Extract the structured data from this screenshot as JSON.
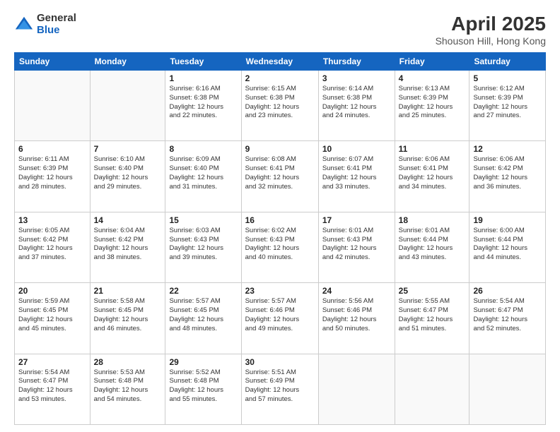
{
  "logo": {
    "general": "General",
    "blue": "Blue"
  },
  "title": "April 2025",
  "location": "Shouson Hill, Hong Kong",
  "days_of_week": [
    "Sunday",
    "Monday",
    "Tuesday",
    "Wednesday",
    "Thursday",
    "Friday",
    "Saturday"
  ],
  "weeks": [
    [
      null,
      null,
      {
        "day": "1",
        "sunrise": "6:16 AM",
        "sunset": "6:38 PM",
        "daylight": "12 hours and 22 minutes."
      },
      {
        "day": "2",
        "sunrise": "6:15 AM",
        "sunset": "6:38 PM",
        "daylight": "12 hours and 23 minutes."
      },
      {
        "day": "3",
        "sunrise": "6:14 AM",
        "sunset": "6:38 PM",
        "daylight": "12 hours and 24 minutes."
      },
      {
        "day": "4",
        "sunrise": "6:13 AM",
        "sunset": "6:39 PM",
        "daylight": "12 hours and 25 minutes."
      },
      {
        "day": "5",
        "sunrise": "6:12 AM",
        "sunset": "6:39 PM",
        "daylight": "12 hours and 27 minutes."
      }
    ],
    [
      {
        "day": "6",
        "sunrise": "6:11 AM",
        "sunset": "6:39 PM",
        "daylight": "12 hours and 28 minutes."
      },
      {
        "day": "7",
        "sunrise": "6:10 AM",
        "sunset": "6:40 PM",
        "daylight": "12 hours and 29 minutes."
      },
      {
        "day": "8",
        "sunrise": "6:09 AM",
        "sunset": "6:40 PM",
        "daylight": "12 hours and 31 minutes."
      },
      {
        "day": "9",
        "sunrise": "6:08 AM",
        "sunset": "6:41 PM",
        "daylight": "12 hours and 32 minutes."
      },
      {
        "day": "10",
        "sunrise": "6:07 AM",
        "sunset": "6:41 PM",
        "daylight": "12 hours and 33 minutes."
      },
      {
        "day": "11",
        "sunrise": "6:06 AM",
        "sunset": "6:41 PM",
        "daylight": "12 hours and 34 minutes."
      },
      {
        "day": "12",
        "sunrise": "6:06 AM",
        "sunset": "6:42 PM",
        "daylight": "12 hours and 36 minutes."
      }
    ],
    [
      {
        "day": "13",
        "sunrise": "6:05 AM",
        "sunset": "6:42 PM",
        "daylight": "12 hours and 37 minutes."
      },
      {
        "day": "14",
        "sunrise": "6:04 AM",
        "sunset": "6:42 PM",
        "daylight": "12 hours and 38 minutes."
      },
      {
        "day": "15",
        "sunrise": "6:03 AM",
        "sunset": "6:43 PM",
        "daylight": "12 hours and 39 minutes."
      },
      {
        "day": "16",
        "sunrise": "6:02 AM",
        "sunset": "6:43 PM",
        "daylight": "12 hours and 40 minutes."
      },
      {
        "day": "17",
        "sunrise": "6:01 AM",
        "sunset": "6:43 PM",
        "daylight": "12 hours and 42 minutes."
      },
      {
        "day": "18",
        "sunrise": "6:01 AM",
        "sunset": "6:44 PM",
        "daylight": "12 hours and 43 minutes."
      },
      {
        "day": "19",
        "sunrise": "6:00 AM",
        "sunset": "6:44 PM",
        "daylight": "12 hours and 44 minutes."
      }
    ],
    [
      {
        "day": "20",
        "sunrise": "5:59 AM",
        "sunset": "6:45 PM",
        "daylight": "12 hours and 45 minutes."
      },
      {
        "day": "21",
        "sunrise": "5:58 AM",
        "sunset": "6:45 PM",
        "daylight": "12 hours and 46 minutes."
      },
      {
        "day": "22",
        "sunrise": "5:57 AM",
        "sunset": "6:45 PM",
        "daylight": "12 hours and 48 minutes."
      },
      {
        "day": "23",
        "sunrise": "5:57 AM",
        "sunset": "6:46 PM",
        "daylight": "12 hours and 49 minutes."
      },
      {
        "day": "24",
        "sunrise": "5:56 AM",
        "sunset": "6:46 PM",
        "daylight": "12 hours and 50 minutes."
      },
      {
        "day": "25",
        "sunrise": "5:55 AM",
        "sunset": "6:47 PM",
        "daylight": "12 hours and 51 minutes."
      },
      {
        "day": "26",
        "sunrise": "5:54 AM",
        "sunset": "6:47 PM",
        "daylight": "12 hours and 52 minutes."
      }
    ],
    [
      {
        "day": "27",
        "sunrise": "5:54 AM",
        "sunset": "6:47 PM",
        "daylight": "12 hours and 53 minutes."
      },
      {
        "day": "28",
        "sunrise": "5:53 AM",
        "sunset": "6:48 PM",
        "daylight": "12 hours and 54 minutes."
      },
      {
        "day": "29",
        "sunrise": "5:52 AM",
        "sunset": "6:48 PM",
        "daylight": "12 hours and 55 minutes."
      },
      {
        "day": "30",
        "sunrise": "5:51 AM",
        "sunset": "6:49 PM",
        "daylight": "12 hours and 57 minutes."
      },
      null,
      null,
      null
    ]
  ],
  "daylight_label": "Daylight:",
  "sunrise_label": "Sunrise:",
  "sunset_label": "Sunset:"
}
